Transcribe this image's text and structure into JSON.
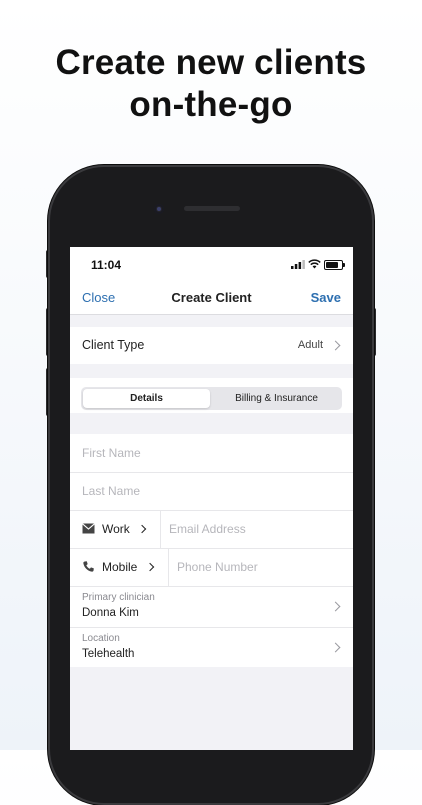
{
  "headline": {
    "line1": "Create new clients",
    "line2": "on-the-go"
  },
  "status_bar": {
    "time": "11:04"
  },
  "nav": {
    "close": "Close",
    "title": "Create Client",
    "save": "Save"
  },
  "client_type": {
    "label": "Client Type",
    "value": "Adult"
  },
  "segment": {
    "options": [
      "Details",
      "Billing & Insurance"
    ],
    "selected": "Details"
  },
  "form": {
    "first_name_placeholder": "First Name",
    "last_name_placeholder": "Last Name",
    "email": {
      "type_label": "Work",
      "icon": "envelope-icon",
      "placeholder": "Email Address"
    },
    "phone": {
      "type_label": "Mobile",
      "icon": "phone-icon",
      "placeholder": "Phone Number"
    },
    "primary_clinician": {
      "label": "Primary clinician",
      "value": "Donna Kim"
    },
    "location": {
      "label": "Location",
      "value": "Telehealth"
    }
  },
  "colors": {
    "accent": "#2d6fb0",
    "background": "#f2f2f6"
  }
}
